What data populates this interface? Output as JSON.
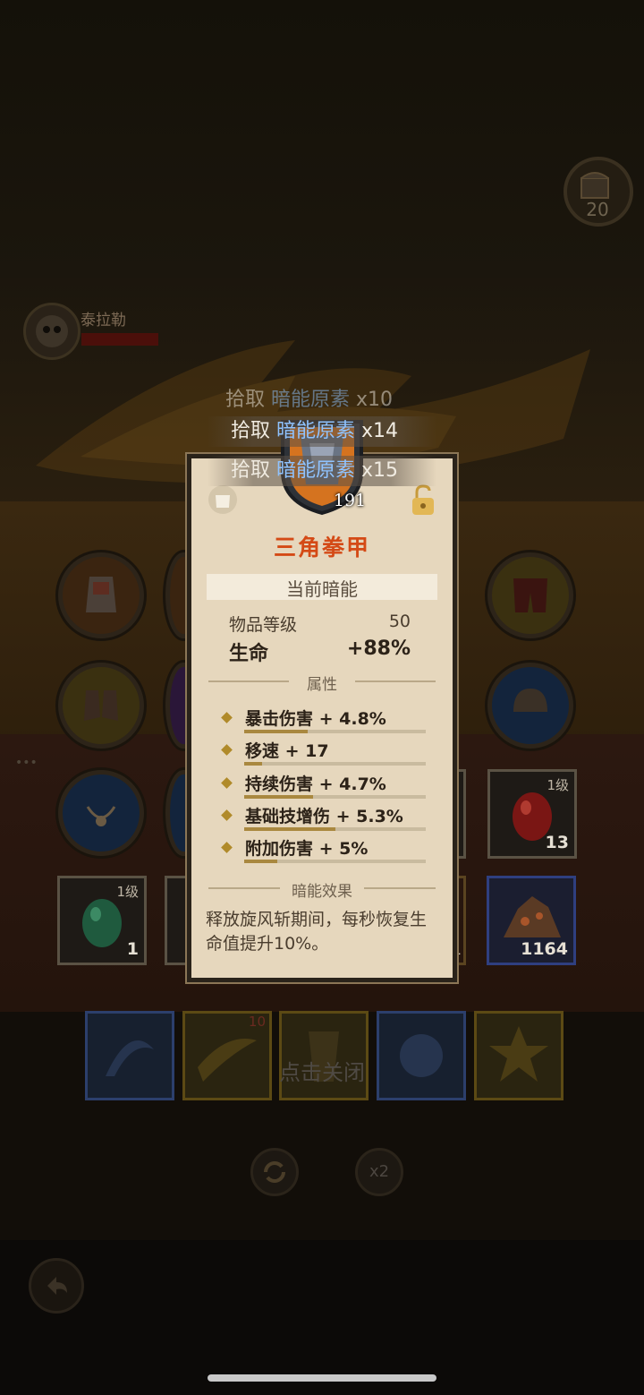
{
  "hud": {
    "chest_count": "20",
    "boss_name": "泰拉勒",
    "boss_hp_fraction": 1.0
  },
  "pickup_log": [
    {
      "prefix": "拾取",
      "item": "暗能原素",
      "qty": "x10"
    },
    {
      "prefix": "拾取",
      "item": "暗能原素",
      "qty": "x14"
    },
    {
      "prefix": "拾取",
      "item": "暗能原素",
      "qty": "x15"
    }
  ],
  "tooltip": {
    "gem_value": "191",
    "name": "三角拳甲",
    "current_label": "当前暗能",
    "item_level_label": "物品等级",
    "item_level_value": "50",
    "main_stat_label": "生命",
    "main_stat_value": "+88%",
    "attributes_header": "属性",
    "attributes": [
      {
        "text": "暴击伤害 + 4.8%",
        "fill": 0.35
      },
      {
        "text": "移速 + 17",
        "fill": 0.1
      },
      {
        "text": "持续伤害 + 4.7%",
        "fill": 0.38
      },
      {
        "text": "基础技增伤 + 5.3%",
        "fill": 0.5
      },
      {
        "text": "附加伤害 + 5%",
        "fill": 0.18
      }
    ],
    "effect_header": "暗能效果",
    "effect_text": "释放旋风斩期间，每秒恢复生命值提升10%。"
  },
  "inventory": {
    "red_egg": {
      "level": "1级",
      "count": "13"
    },
    "green_egg": {
      "level": "1级",
      "count": "1"
    },
    "ore": {
      "count": "1164"
    },
    "partial_left_count": "1"
  },
  "skills": {
    "badge_count": "10"
  },
  "close_hint": "点击关闭",
  "speed_button": "x2",
  "colors": {
    "panel_bg": "#e6d7bd",
    "name_orange": "#d44a16",
    "pickup_blue": "#8fc3ff",
    "bar_fill": "#a9883f"
  }
}
